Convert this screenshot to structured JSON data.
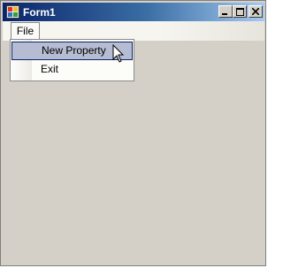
{
  "window": {
    "title": "Form1",
    "icon": "form-icon",
    "caption_buttons": [
      "minimize-icon",
      "maximize-icon",
      "close-icon"
    ]
  },
  "menubar": {
    "items": [
      {
        "label": "File"
      }
    ]
  },
  "file_menu": {
    "items": [
      {
        "label": "New Property",
        "highlighted": true
      },
      {
        "label": "Exit",
        "highlighted": false
      }
    ]
  },
  "colors": {
    "title_start": "#0a246a",
    "title_end": "#a6caf0",
    "client_background": "#d4d0c8",
    "menu_highlight": "#b6bdd2"
  }
}
